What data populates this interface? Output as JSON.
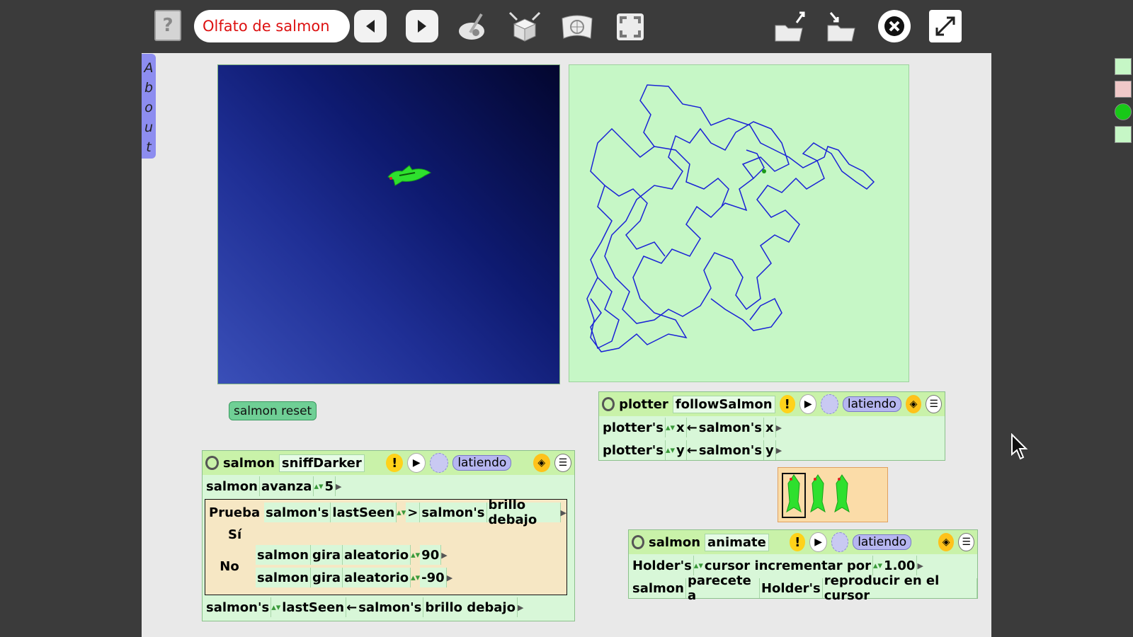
{
  "toolbar": {
    "help_label": "?",
    "project_title": "Olfato de salmon"
  },
  "about_tab": {
    "letters": [
      "A",
      "b",
      "o",
      "u",
      "t"
    ]
  },
  "reset_button": "salmon reset",
  "script_plotter": {
    "object": "plotter",
    "name": "followSalmon",
    "status": "latiendo",
    "rows": [
      {
        "target": "plotter's",
        "var": "x",
        "arrow": "←",
        "source": "salmon's",
        "attr": "x"
      },
      {
        "target": "plotter's",
        "var": "y",
        "arrow": "←",
        "source": "salmon's",
        "attr": "y"
      }
    ]
  },
  "script_sniff": {
    "object": "salmon",
    "name": "sniffDarker",
    "status": "latiendo",
    "row1": {
      "obj": "salmon",
      "cmd": "avanza",
      "val": "5"
    },
    "test": {
      "label": "Prueba",
      "a_obj": "salmon's",
      "a_attr": "lastSeen",
      "op": ">",
      "b_obj": "salmon's",
      "b_attr": "brillo debajo",
      "yes": "Sí",
      "no": "No",
      "no_rows": [
        {
          "obj": "salmon",
          "cmd": "gira",
          "fn": "aleatorio",
          "val": "90"
        },
        {
          "obj": "salmon",
          "cmd": "gira",
          "fn": "aleatorio",
          "val": "-90"
        }
      ]
    },
    "last_row": {
      "target": "salmon's",
      "var": "lastSeen",
      "arrow": "←",
      "source": "salmon's",
      "attr": "brillo debajo"
    }
  },
  "script_animate": {
    "object": "salmon",
    "name": "animate",
    "status": "latiendo",
    "row1": {
      "obj": "Holder's",
      "cmd": "cursor incrementar por",
      "val": "1.00"
    },
    "row2": {
      "obj": "salmon",
      "cmd": "parecete a",
      "holder": "Holder's",
      "action": "reproducir en el cursor"
    }
  },
  "colors": {
    "background": "#3b3b3b",
    "world": "#e9e9e9",
    "plot_bg": "#c6f7c6",
    "plot_line": "#1a22d6",
    "title_text": "#dd1111",
    "script_header": "#c9f2a9"
  }
}
